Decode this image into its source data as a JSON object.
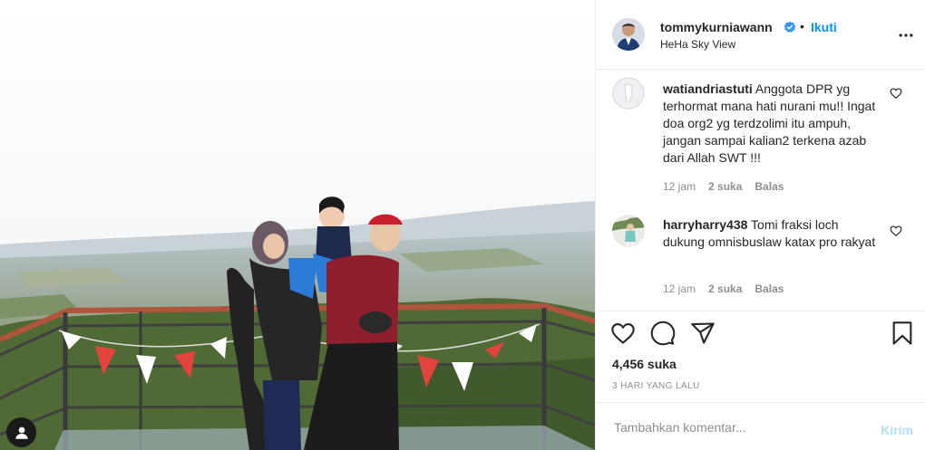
{
  "post": {
    "username": "tommykurniawann",
    "follow_label": "Ikuti",
    "separator": "•",
    "location": "HeHa Sky View",
    "more_icon": "more-horizontal-icon",
    "verified_icon": "verified-badge-icon",
    "accent_color": "#0095f6"
  },
  "comments": [
    {
      "username": "watiandriastuti",
      "text": "Anggota DPR yg terhormat mana hati nurani mu!! Ingat doa org2 yg terdzolimi itu ampuh, jangan sampai kalian2 terkena azab dari Allah SWT !!!",
      "age": "12 jam",
      "likes": "2 suka",
      "reply": "Balas"
    },
    {
      "username": "harryharry438",
      "text": "Tomi fraksi loch dukung omnisbuslaw katax pro rakyat",
      "age": "12 jam",
      "likes": "2 suka",
      "reply": "Balas"
    }
  ],
  "actions": {
    "like_icon": "heart-icon",
    "comment_icon": "comment-icon",
    "share_icon": "paper-plane-icon",
    "save_icon": "bookmark-icon"
  },
  "likes_count": "4,456 suka",
  "timestamp": "3 HARI YANG LALU",
  "add_comment": {
    "placeholder": "Tambahkan komentar...",
    "post_label": "Kirim"
  }
}
